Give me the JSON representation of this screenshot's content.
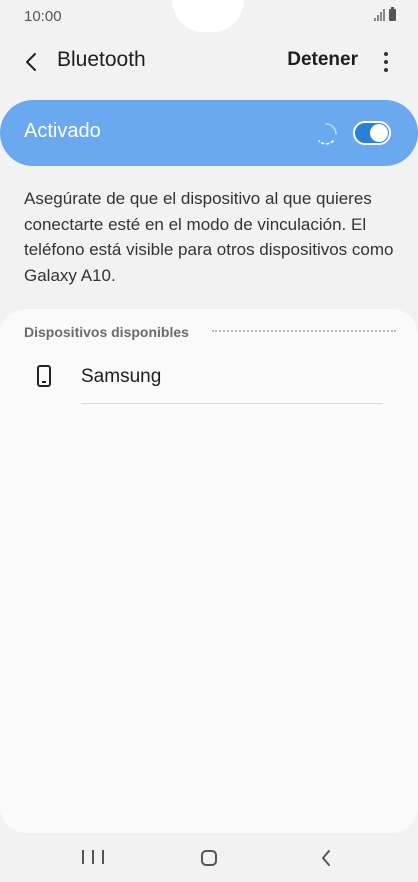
{
  "status_bar": {
    "time": "10:00",
    "icons": [
      "signal-icon",
      "battery-icon"
    ]
  },
  "app_bar": {
    "title": "Bluetooth",
    "stop_label": "Detener",
    "icons": [
      "back-icon",
      "more-options-icon"
    ]
  },
  "master_switch": {
    "label": "Activado",
    "enabled": true,
    "scanning": true,
    "background_color": "#6aa8ef",
    "toggle_color": "#2a7fd9"
  },
  "description": "Asegúrate de que el dispositivo al que quieres conectarte esté en el modo de vinculación. El teléfono está visible para otros dispositivos como Galaxy A10.",
  "available_devices": {
    "header": "Dispositivos disponibles",
    "items": [
      {
        "name": "Samsung",
        "icon": "phone-icon"
      }
    ]
  },
  "nav_bar": {
    "icons": [
      "recent-apps-icon",
      "home-icon",
      "back-icon"
    ]
  }
}
